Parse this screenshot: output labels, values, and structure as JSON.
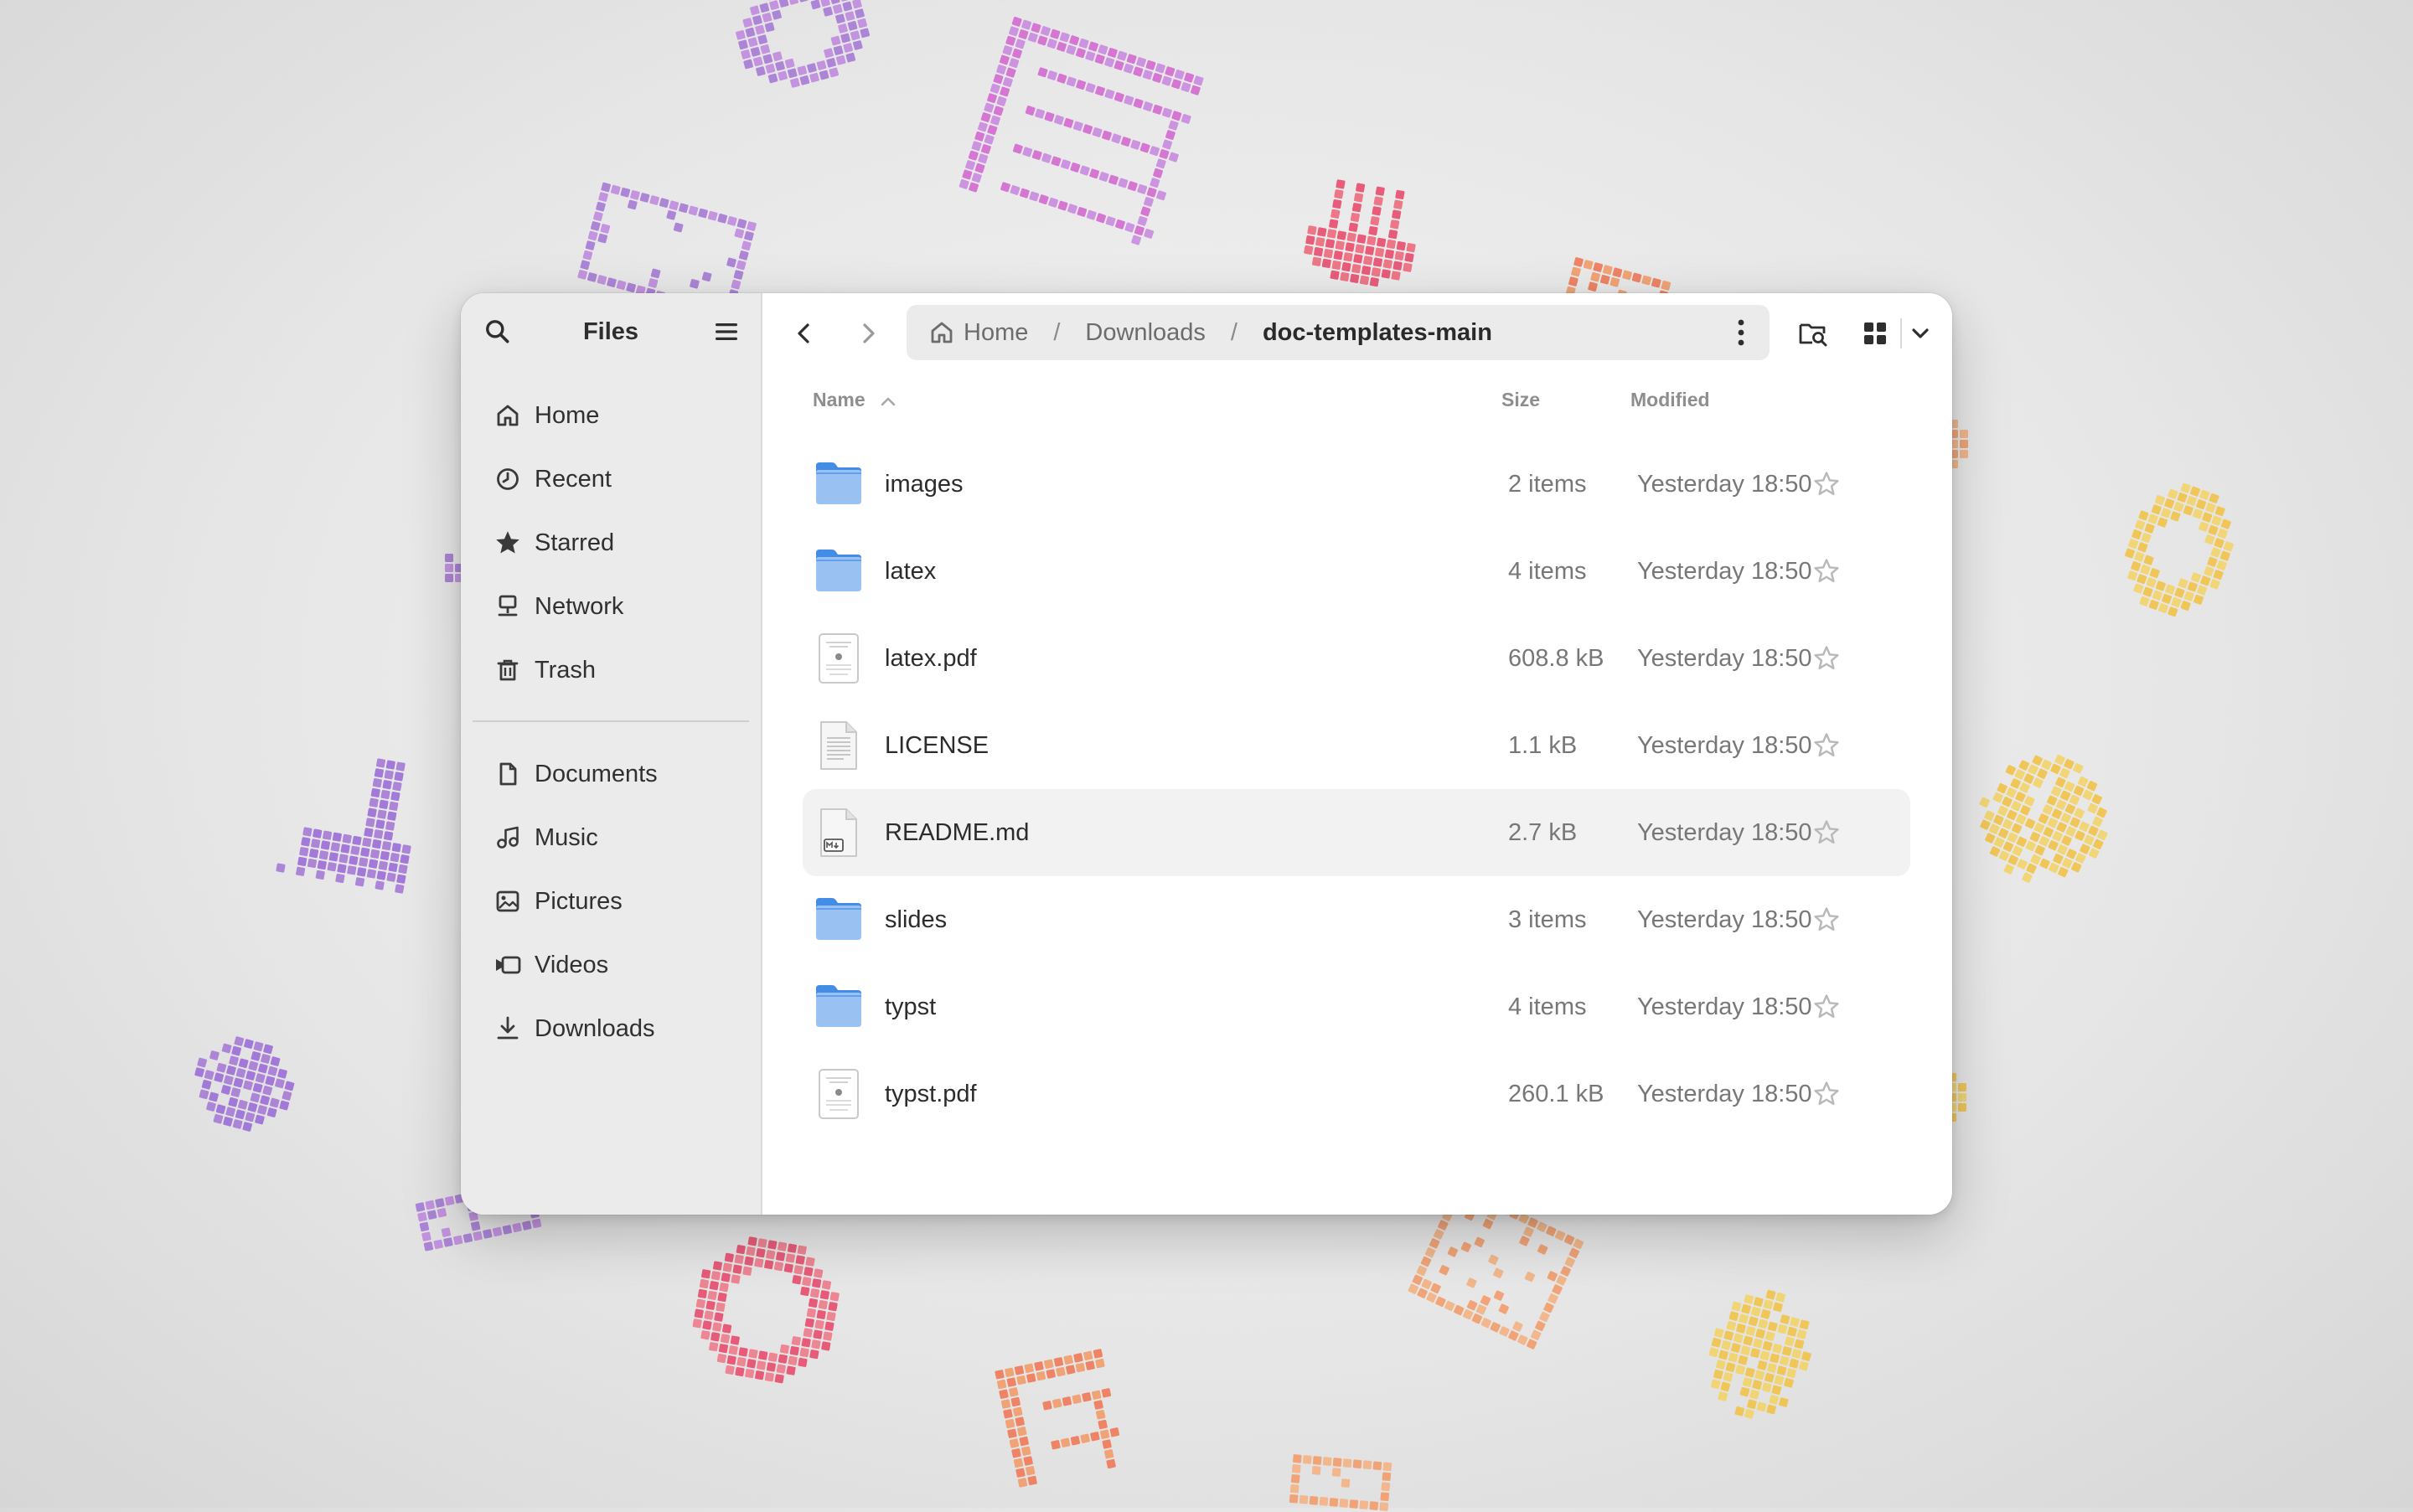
{
  "sidebar": {
    "title": "Files",
    "places": [
      {
        "label": "Home",
        "icon": "home-icon"
      },
      {
        "label": "Recent",
        "icon": "clock-icon"
      },
      {
        "label": "Starred",
        "icon": "star-icon"
      },
      {
        "label": "Network",
        "icon": "network-icon"
      },
      {
        "label": "Trash",
        "icon": "trash-icon"
      }
    ],
    "bookmarks": [
      {
        "label": "Documents",
        "icon": "document-icon"
      },
      {
        "label": "Music",
        "icon": "music-icon"
      },
      {
        "label": "Pictures",
        "icon": "picture-icon"
      },
      {
        "label": "Videos",
        "icon": "video-icon"
      },
      {
        "label": "Downloads",
        "icon": "download-icon"
      }
    ]
  },
  "path": {
    "home": "Home",
    "downloads": "Downloads",
    "current": "doc-templates-main",
    "separator": "/"
  },
  "columns": {
    "name": "Name",
    "size": "Size",
    "modified": "Modified"
  },
  "files": [
    {
      "name": "images",
      "size": "2 items",
      "modified": "Yesterday 18:50",
      "type": "folder"
    },
    {
      "name": "latex",
      "size": "4 items",
      "modified": "Yesterday 18:50",
      "type": "folder"
    },
    {
      "name": "latex.pdf",
      "size": "608.8 kB",
      "modified": "Yesterday 18:50",
      "type": "pdf"
    },
    {
      "name": "LICENSE",
      "size": "1.1 kB",
      "modified": "Yesterday 18:50",
      "type": "text"
    },
    {
      "name": "README.md",
      "size": "2.7 kB",
      "modified": "Yesterday 18:50",
      "type": "markdown",
      "hovered": true
    },
    {
      "name": "slides",
      "size": "3 items",
      "modified": "Yesterday 18:50",
      "type": "folder"
    },
    {
      "name": "typst",
      "size": "4 items",
      "modified": "Yesterday 18:50",
      "type": "folder"
    },
    {
      "name": "typst.pdf",
      "size": "260.1 kB",
      "modified": "Yesterday 18:50",
      "type": "pdf"
    }
  ],
  "colors": {
    "folder": "#62a0ea",
    "folder_light": "#99c1f1",
    "accent": "#3584e4"
  }
}
